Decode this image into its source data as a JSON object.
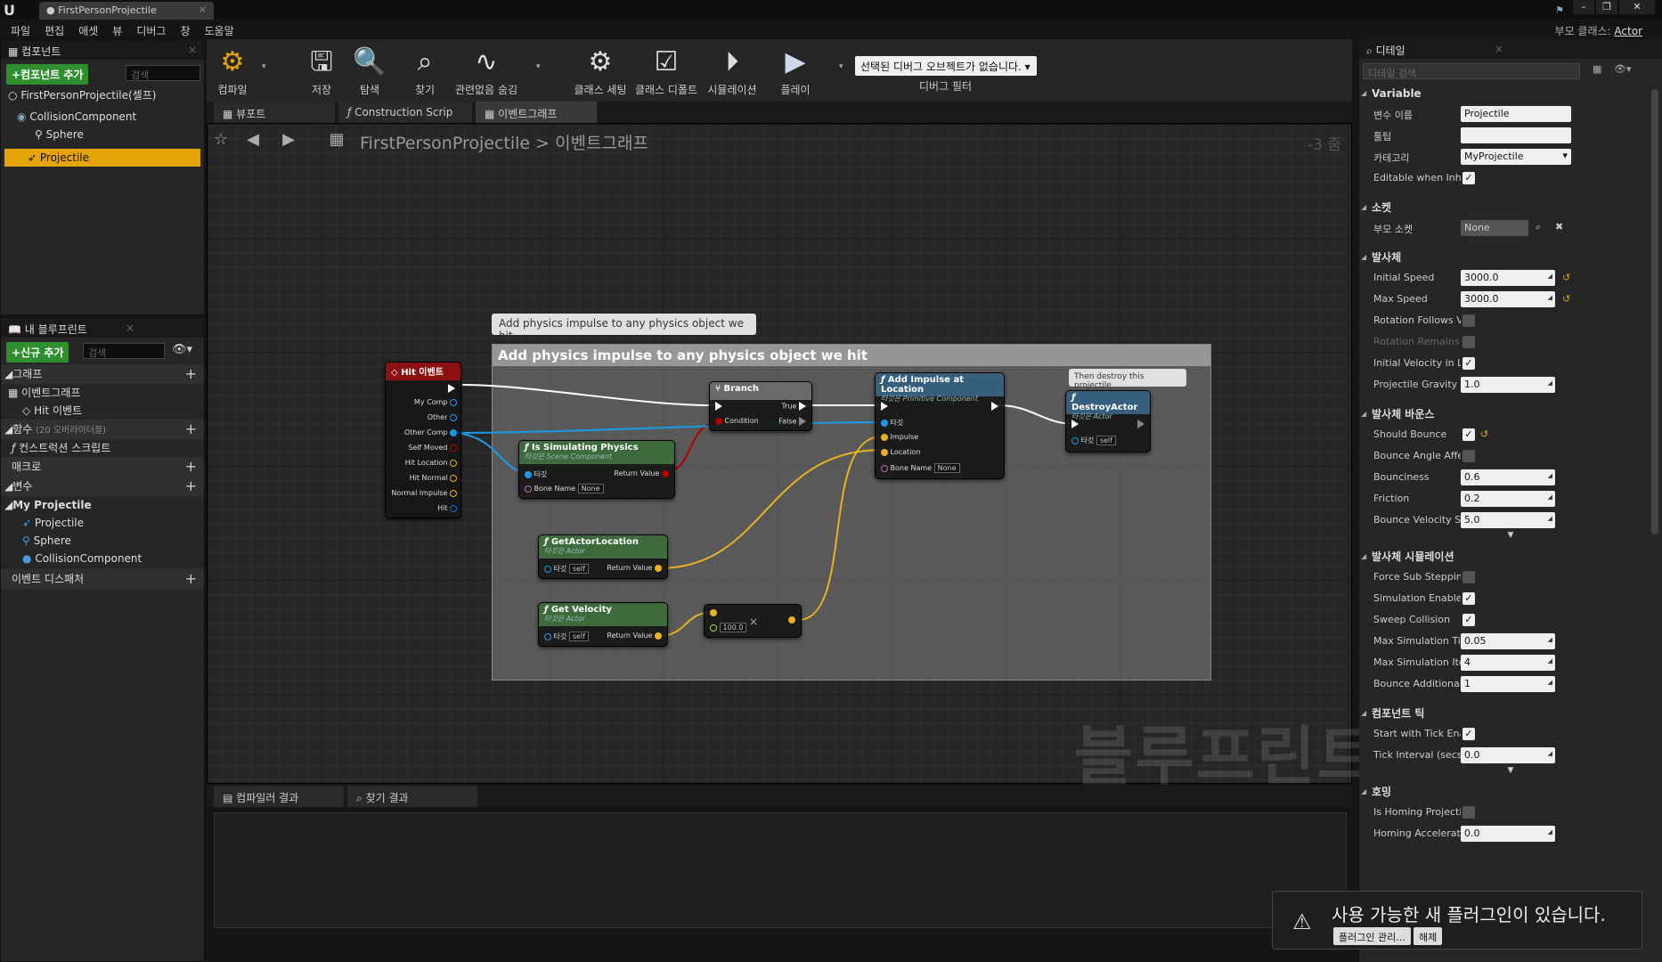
{
  "window": {
    "tab_title": "FirstPersonProjectile",
    "parent_class_label": "부모 클래스:",
    "parent_class_value": "Actor"
  },
  "menu": [
    "파일",
    "편집",
    "애셋",
    "뷰",
    "디버그",
    "창",
    "도움말"
  ],
  "components_panel": {
    "title": "컴포넌트",
    "add_button": "+컴포넌트 추가",
    "search_placeholder": "검색",
    "self_item": "FirstPersonProjectile(셀프)",
    "items": [
      "CollisionComponent",
      "Sphere",
      "Projectile"
    ]
  },
  "my_blueprint": {
    "title": "내 블루프린트",
    "add_button": "+신규 추가",
    "search_placeholder": "검색",
    "graphs_label": "그래프",
    "event_graph": "이벤트그래프",
    "hit_event": "Hit 이벤트",
    "functions_label": "함수",
    "functions_overridable": "(20 오버라이더블)",
    "construction_script": "컨스트럭션 스크립트",
    "macros_label": "매크로",
    "variables_label": "변수",
    "my_projectile_label": "My Projectile",
    "variables": [
      "Projectile",
      "Sphere",
      "CollisionComponent"
    ],
    "dispatchers_label": "이벤트 디스패처"
  },
  "toolbar": {
    "buttons": [
      "컴파일",
      "저장",
      "탐색",
      "찾기",
      "관련없음 숨김",
      "클래스 세팅",
      "클래스 디폴트",
      "시뮬레이션",
      "플레이"
    ],
    "debug_filter": "선택된 디버그 오브젝트가 없습니다.",
    "debug_label": "디버그 필터"
  },
  "graph_tabs": [
    "뷰포트",
    "Construction Scrip",
    "이벤트그래프"
  ],
  "graph": {
    "breadcrumb_root": "FirstPersonProjectile",
    "breadcrumb_sep": ">",
    "breadcrumb_current": "이벤트그래프",
    "zoom": "-3 줌",
    "watermark": "블루프린트",
    "comment_bubble": "Add physics impulse to any physics object we hit",
    "comment_title": "Add physics impulse to any physics object we hit",
    "destroy_bubble": "Then destroy this projectile",
    "nodes": {
      "hit": {
        "title": "Hit 이벤트",
        "pins": [
          "My Comp",
          "Other",
          "Other Comp",
          "Self Moved",
          "Hit Location",
          "Hit Normal",
          "Normal Impulse",
          "Hit"
        ]
      },
      "branch": {
        "title": "Branch",
        "condition": "Condition",
        "true": "True",
        "false": "False"
      },
      "is_sim": {
        "title": "Is Simulating Physics",
        "sub": "타깃은 Scene Component",
        "target": "타깃",
        "bone": "Bone Name",
        "bone_value": "None",
        "ret": "Return Value"
      },
      "add_impulse": {
        "title": "Add Impulse at Location",
        "sub": "타깃은 Primitive Component",
        "target": "타깃",
        "impulse": "Impulse",
        "location": "Location",
        "bone": "Bone Name",
        "bone_value": "None"
      },
      "destroy": {
        "title": "DestroyActor",
        "sub": "타깃은 Actor",
        "target": "타깃",
        "self": "self"
      },
      "get_loc": {
        "title": "GetActorLocation",
        "sub": "타깃은 Actor",
        "target": "타깃",
        "self": "self",
        "ret": "Return Value"
      },
      "get_vel": {
        "title": "Get Velocity",
        "sub": "타깃은 Actor",
        "target": "타깃",
        "self": "self",
        "ret": "Return Value"
      },
      "multiply": {
        "value": "100.0",
        "op": "×"
      }
    }
  },
  "results_tabs": [
    "컴파일러 결과",
    "찾기 결과"
  ],
  "details": {
    "title": "디테일",
    "search_placeholder": "디테일 검색",
    "sec_variable": "Variable",
    "var_name_label": "변수 이름",
    "var_name_value": "Projectile",
    "tooltip_label": "툴팁",
    "category_label": "카테고리",
    "category_value": "MyProjectile",
    "editable_label": "Editable when Inhe",
    "sec_socket": "소켓",
    "parent_socket_label": "부모 소켓",
    "parent_socket_value": "None",
    "sec_projectile": "발사체",
    "initial_speed_label": "Initial Speed",
    "initial_speed": "3000.0",
    "max_speed_label": "Max Speed",
    "max_speed": "3000.0",
    "rot_follows_label": "Rotation Follows V",
    "rot_remains_label": "Rotation Remains",
    "init_vel_label": "Initial Velocity in L",
    "gravity_label": "Projectile Gravity S",
    "gravity": "1.0",
    "sec_bounce": "발사체 바운스",
    "should_bounce_label": "Should Bounce",
    "bounce_angle_label": "Bounce Angle Affe",
    "bounciness_label": "Bounciness",
    "bounciness": "0.6",
    "friction_label": "Friction",
    "friction": "0.2",
    "bounce_vel_label": "Bounce Velocity St",
    "bounce_vel": "5.0",
    "sec_sim": "발사체 시뮬레이션",
    "force_sub_label": "Force Sub Steppin",
    "sim_enabled_label": "Simulation Enablec",
    "sweep_label": "Sweep Collision",
    "max_sim_time_label": "Max Simulation Ti",
    "max_sim_time": "0.05",
    "max_sim_iter_label": "Max Simulation Ite",
    "max_sim_iter": "4",
    "bounce_add_label": "Bounce Additional",
    "bounce_add": "1",
    "sec_tick": "컴포넌트 틱",
    "start_tick_label": "Start with Tick Ena",
    "tick_interval_label": "Tick Interval (secs",
    "tick_interval": "0.0",
    "sec_homing": "호밍",
    "is_homing_label": "Is Homing Projecti",
    "homing_accel_label": "Homing Accelerati",
    "homing_accel": "0.0"
  },
  "notification": {
    "text": "사용 가능한 새 플러그인이 있습니다.",
    "manage": "플러그인 관리...",
    "dismiss": "해제"
  }
}
